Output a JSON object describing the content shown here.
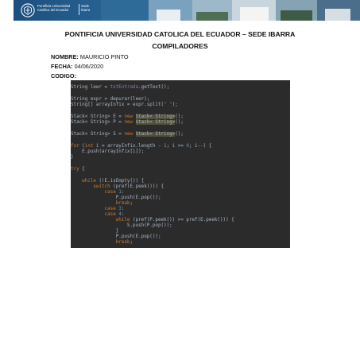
{
  "banner": {
    "university_line1": "Pontificia Universidad",
    "university_line2": "Católica del Ecuador",
    "sede_line1": "Sede",
    "sede_line2": "Ibarra"
  },
  "document": {
    "title": "PONTIFICIA UNIVERSIDAD CATOLICA DEL ECUADOR – SEDE IBARRA",
    "subtitle": "COMPILADORES",
    "nombre_label": "NOMBRE:",
    "nombre_value": "MAURICIO PINTO",
    "fecha_label": "FECHA:",
    "fecha_value": "04/06/2020",
    "codigo_label": "CODIGO:"
  },
  "code": {
    "l1a": "String leer = ",
    "l1b": "txtEntrada",
    "l1c": ".getText();",
    "l2": "String expr = depurar(leer);",
    "l3a": "String[] arrayInfix = expr.split(",
    "l3b": "\" \"",
    "l3c": ");",
    "l4a": "Stack< String> E = ",
    "l4b": "new",
    "l4c": "Stack< String>",
    "l4d": "();",
    "l5a": "Stack< String> P = ",
    "l5b": "new",
    "l5c": "Stack< String>",
    "l5d": "();",
    "l6a": "Stack< String> S = ",
    "l6b": "new",
    "l6c": "Stack< String>",
    "l6d": "();",
    "l7a": "for",
    "l7b": " (",
    "l7c": "int",
    "l7d": " i = arrayInfix.length - ",
    "l7e": "1",
    "l7f": "; i >= ",
    "l7g": "0",
    "l7h": "; i--) {",
    "l8": "    E.push(arrayInfix[i]);",
    "l9": "}",
    "l10a": "try",
    "l10b": " {",
    "l11a": "    while",
    "l11b": " (!E.isEmpty()) {",
    "l12a": "        switch",
    "l12b": " (pref(E.peek())) {",
    "l13a": "            case",
    "l13b": " ",
    "l13c": "1",
    "l13d": ":",
    "l14": "                P.push(E.pop());",
    "l15a": "                break",
    "l15b": ";",
    "l16a": "            case",
    "l16b": " ",
    "l16c": "3",
    "l16d": ":",
    "l17a": "            case",
    "l17b": " ",
    "l17c": "4",
    "l17d": ":",
    "l18a": "                while",
    "l18b": " (pref(P.peek()) >= pref(E.peek())) {",
    "l19": "                    S.push(P.pop());",
    "l20": "                }",
    "l21": "                P.push(E.pop());",
    "l22a": "                break",
    "l22b": ";"
  },
  "colors": {
    "banner_blue": "#1d4f7e",
    "code_background": "#2b2b2b",
    "keyword": "#cc7832",
    "string": "#6a8759",
    "number": "#6897bb"
  }
}
